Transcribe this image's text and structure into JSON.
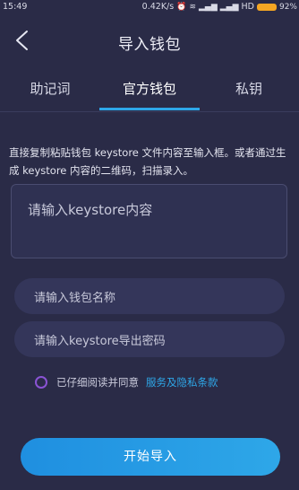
{
  "status_bar": {
    "time": "15:49",
    "network_speed": "0.42K/s",
    "network_label": "HD",
    "battery_percent": "92%"
  },
  "header": {
    "title": "导入钱包"
  },
  "tabs": [
    {
      "label": "助记词"
    },
    {
      "label": "官方钱包",
      "active": true
    },
    {
      "label": "私钥"
    }
  ],
  "hint_text": "直接复制粘贴钱包 keystore 文件内容至输入框。或者通过生成 keystore 内容的二维码，扫描录入。",
  "keystore_input": {
    "placeholder": "请输入keystore内容"
  },
  "wallet_name_input": {
    "placeholder": "请输入钱包名称"
  },
  "export_password_input": {
    "placeholder": "请输入keystore导出密码"
  },
  "agreement": {
    "text": "已仔细阅读并同意",
    "link": "服务及隐私条款"
  },
  "start_button": {
    "label": "开始导入"
  },
  "colors": {
    "background": "#2a2b47",
    "accent": "#2ea7e8",
    "checkbox": "#8a53d4"
  }
}
